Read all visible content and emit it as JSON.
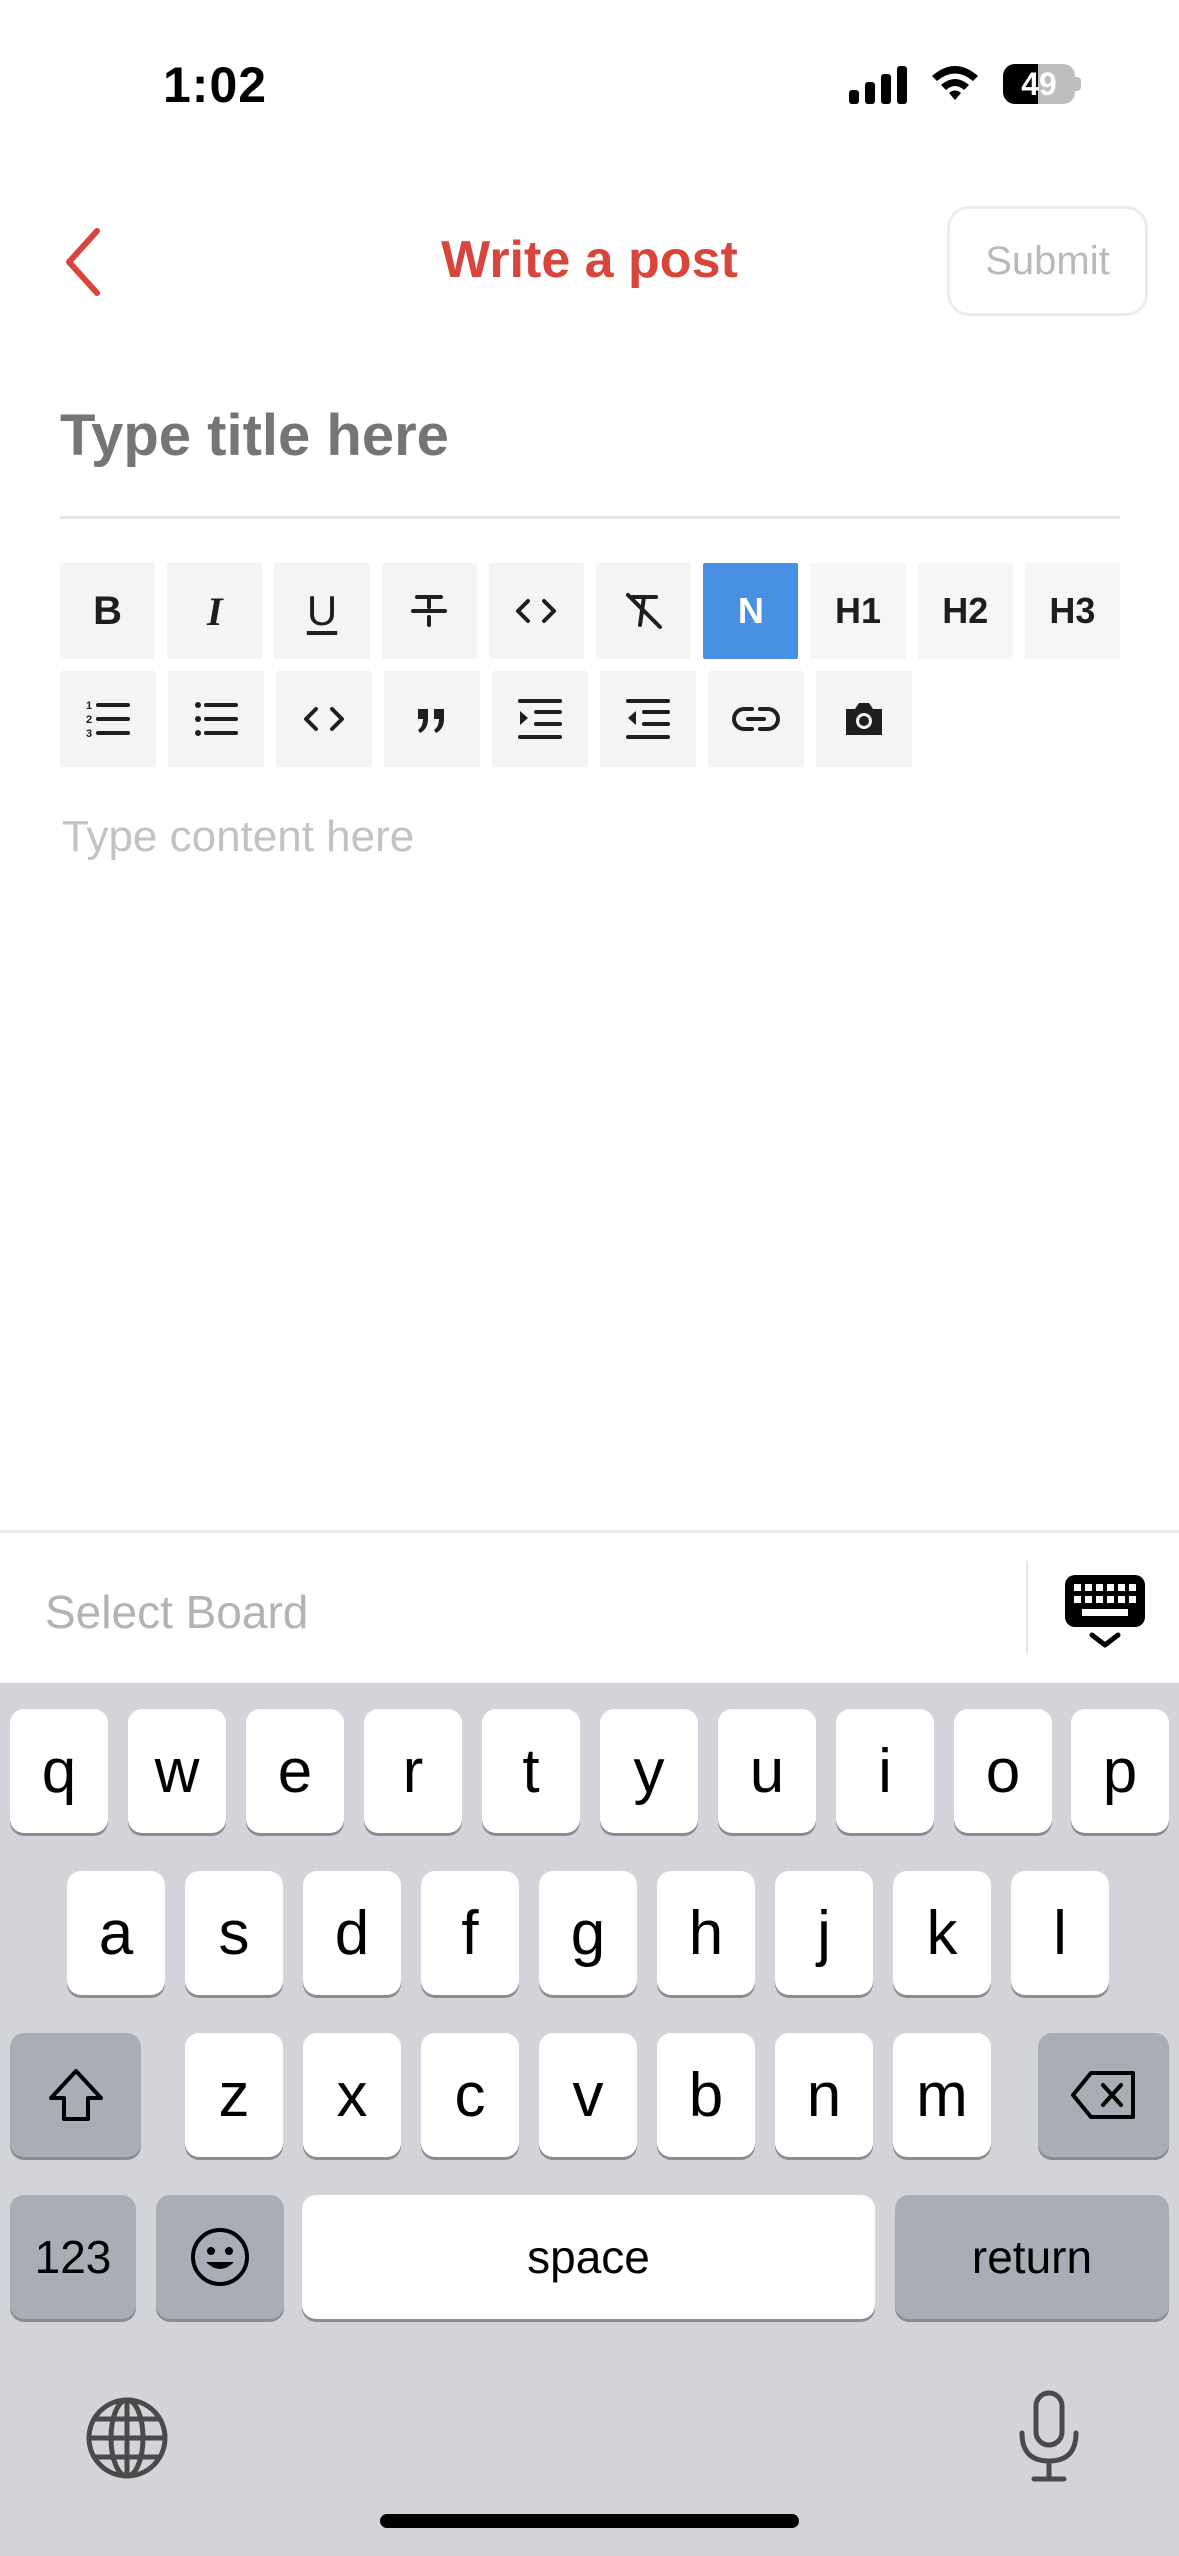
{
  "status_bar": {
    "time": "1:02",
    "battery": "49",
    "battery_level": 0.49
  },
  "header": {
    "title": "Write a post",
    "submit_label": "Submit"
  },
  "editor": {
    "title_placeholder": "Type title here",
    "content_placeholder": "Type content here"
  },
  "toolbar": {
    "row1": [
      {
        "name": "bold-icon",
        "label": "B"
      },
      {
        "name": "italic-icon",
        "label": "I"
      },
      {
        "name": "underline-icon",
        "label": "U"
      },
      {
        "name": "strikethrough-icon",
        "label": ""
      },
      {
        "name": "inline-code-icon",
        "label": ""
      },
      {
        "name": "clear-format-icon",
        "label": ""
      },
      {
        "name": "normal-text",
        "label": "N",
        "active": true
      },
      {
        "name": "heading-1",
        "label": "H1"
      },
      {
        "name": "heading-2",
        "label": "H2"
      },
      {
        "name": "heading-3",
        "label": "H3"
      }
    ],
    "row2": [
      {
        "name": "ordered-list-icon"
      },
      {
        "name": "bullet-list-icon"
      },
      {
        "name": "code-block-icon"
      },
      {
        "name": "blockquote-icon"
      },
      {
        "name": "indent-icon"
      },
      {
        "name": "outdent-icon"
      },
      {
        "name": "link-icon"
      },
      {
        "name": "camera-icon"
      }
    ],
    "active_color": "#4a90e2"
  },
  "accessory": {
    "select_board": "Select Board"
  },
  "keyboard": {
    "row1": [
      "q",
      "w",
      "e",
      "r",
      "t",
      "y",
      "u",
      "i",
      "o",
      "p"
    ],
    "row2": [
      "a",
      "s",
      "d",
      "f",
      "g",
      "h",
      "j",
      "k",
      "l"
    ],
    "row3": [
      "z",
      "x",
      "c",
      "v",
      "b",
      "n",
      "m"
    ],
    "numbers_label": "123",
    "space_label": "space",
    "return_label": "return"
  },
  "colors": {
    "accent": "#d9443b",
    "keyboard_bg": "#d2d4d9"
  }
}
